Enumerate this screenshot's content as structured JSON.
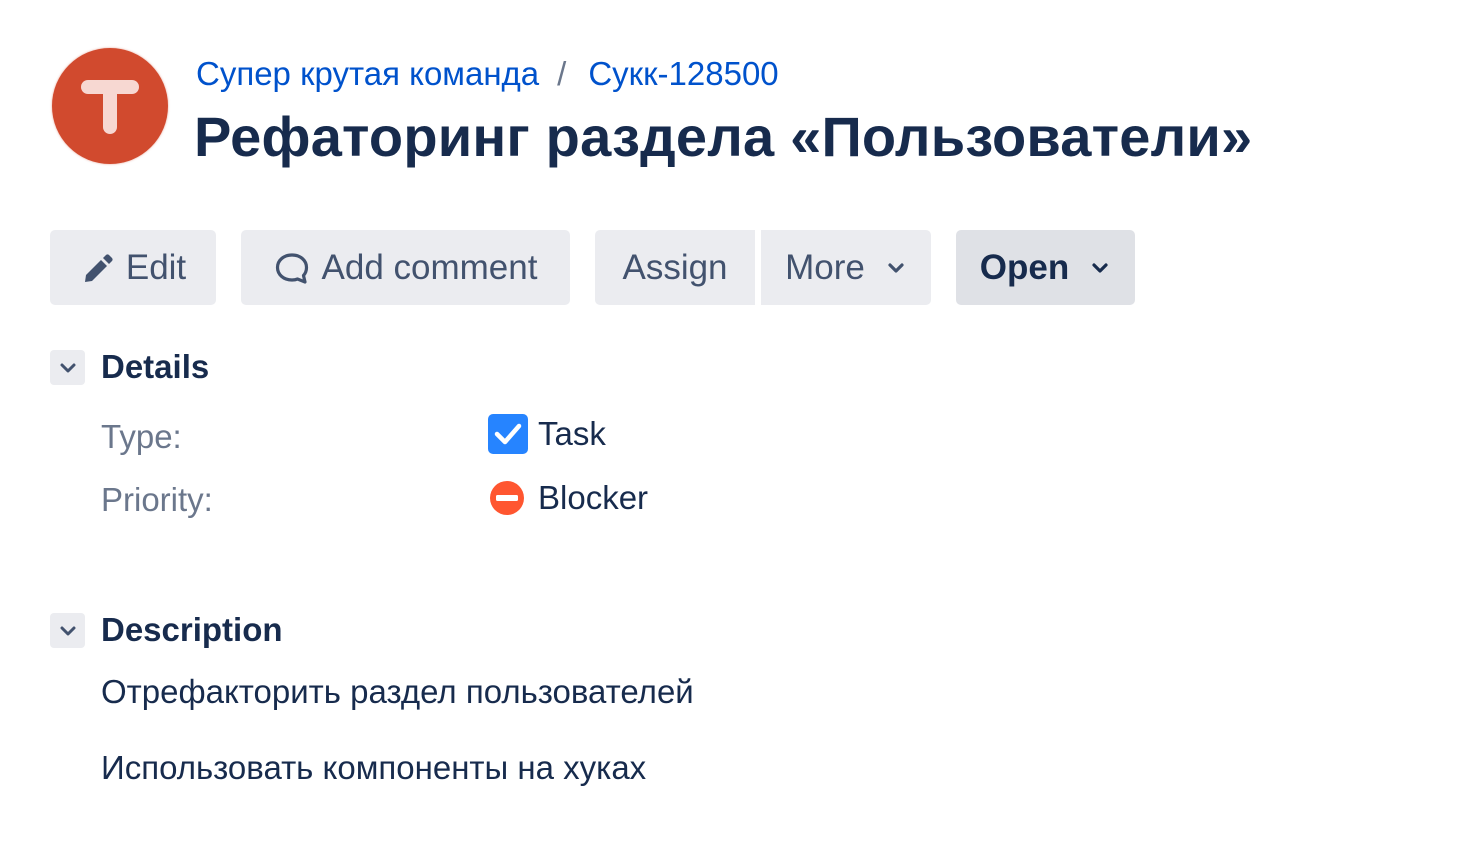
{
  "project": {
    "avatar_letter": "T",
    "avatar_color": "#d14a2e"
  },
  "breadcrumbs": {
    "project_name": "Супер крутая команда",
    "separator": "/",
    "issue_key": "Сукк-128500"
  },
  "issue": {
    "title": "Рефаторинг раздела «Пользователи»"
  },
  "toolbar": {
    "edit_label": "Edit",
    "edit_icon": "pencil-icon",
    "comment_label": "Add comment",
    "comment_icon": "comment-bubble-icon",
    "assign_label": "Assign",
    "more_label": "More",
    "status_label": "Open"
  },
  "details": {
    "heading": "Details",
    "fields": [
      {
        "label": "Type:",
        "value": "Task",
        "icon": "task-checkbox-icon",
        "icon_color": "#2684ff"
      },
      {
        "label": "Priority:",
        "value": "Blocker",
        "icon": "blocker-icon",
        "icon_color": "#ff5630"
      }
    ]
  },
  "description": {
    "heading": "Description",
    "lines": [
      "Отрефакторить раздел пользователей",
      "Использовать компоненты на хуках"
    ]
  },
  "colors": {
    "link": "#0052cc",
    "text": "#172b4d",
    "muted": "#6b778c",
    "button_bg": "#ebecf0"
  }
}
